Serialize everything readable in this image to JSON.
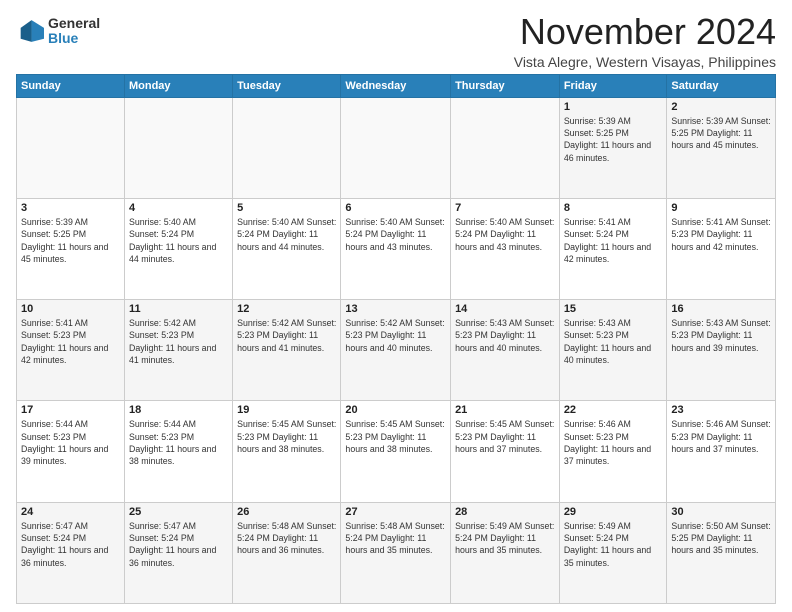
{
  "logo": {
    "general": "General",
    "blue": "Blue"
  },
  "header": {
    "month": "November 2024",
    "location": "Vista Alegre, Western Visayas, Philippines"
  },
  "weekdays": [
    "Sunday",
    "Monday",
    "Tuesday",
    "Wednesday",
    "Thursday",
    "Friday",
    "Saturday"
  ],
  "weeks": [
    [
      {
        "day": "",
        "info": ""
      },
      {
        "day": "",
        "info": ""
      },
      {
        "day": "",
        "info": ""
      },
      {
        "day": "",
        "info": ""
      },
      {
        "day": "",
        "info": ""
      },
      {
        "day": "1",
        "info": "Sunrise: 5:39 AM\nSunset: 5:25 PM\nDaylight: 11 hours\nand 46 minutes."
      },
      {
        "day": "2",
        "info": "Sunrise: 5:39 AM\nSunset: 5:25 PM\nDaylight: 11 hours\nand 45 minutes."
      }
    ],
    [
      {
        "day": "3",
        "info": "Sunrise: 5:39 AM\nSunset: 5:25 PM\nDaylight: 11 hours\nand 45 minutes."
      },
      {
        "day": "4",
        "info": "Sunrise: 5:40 AM\nSunset: 5:24 PM\nDaylight: 11 hours\nand 44 minutes."
      },
      {
        "day": "5",
        "info": "Sunrise: 5:40 AM\nSunset: 5:24 PM\nDaylight: 11 hours\nand 44 minutes."
      },
      {
        "day": "6",
        "info": "Sunrise: 5:40 AM\nSunset: 5:24 PM\nDaylight: 11 hours\nand 43 minutes."
      },
      {
        "day": "7",
        "info": "Sunrise: 5:40 AM\nSunset: 5:24 PM\nDaylight: 11 hours\nand 43 minutes."
      },
      {
        "day": "8",
        "info": "Sunrise: 5:41 AM\nSunset: 5:24 PM\nDaylight: 11 hours\nand 42 minutes."
      },
      {
        "day": "9",
        "info": "Sunrise: 5:41 AM\nSunset: 5:23 PM\nDaylight: 11 hours\nand 42 minutes."
      }
    ],
    [
      {
        "day": "10",
        "info": "Sunrise: 5:41 AM\nSunset: 5:23 PM\nDaylight: 11 hours\nand 42 minutes."
      },
      {
        "day": "11",
        "info": "Sunrise: 5:42 AM\nSunset: 5:23 PM\nDaylight: 11 hours\nand 41 minutes."
      },
      {
        "day": "12",
        "info": "Sunrise: 5:42 AM\nSunset: 5:23 PM\nDaylight: 11 hours\nand 41 minutes."
      },
      {
        "day": "13",
        "info": "Sunrise: 5:42 AM\nSunset: 5:23 PM\nDaylight: 11 hours\nand 40 minutes."
      },
      {
        "day": "14",
        "info": "Sunrise: 5:43 AM\nSunset: 5:23 PM\nDaylight: 11 hours\nand 40 minutes."
      },
      {
        "day": "15",
        "info": "Sunrise: 5:43 AM\nSunset: 5:23 PM\nDaylight: 11 hours\nand 40 minutes."
      },
      {
        "day": "16",
        "info": "Sunrise: 5:43 AM\nSunset: 5:23 PM\nDaylight: 11 hours\nand 39 minutes."
      }
    ],
    [
      {
        "day": "17",
        "info": "Sunrise: 5:44 AM\nSunset: 5:23 PM\nDaylight: 11 hours\nand 39 minutes."
      },
      {
        "day": "18",
        "info": "Sunrise: 5:44 AM\nSunset: 5:23 PM\nDaylight: 11 hours\nand 38 minutes."
      },
      {
        "day": "19",
        "info": "Sunrise: 5:45 AM\nSunset: 5:23 PM\nDaylight: 11 hours\nand 38 minutes."
      },
      {
        "day": "20",
        "info": "Sunrise: 5:45 AM\nSunset: 5:23 PM\nDaylight: 11 hours\nand 38 minutes."
      },
      {
        "day": "21",
        "info": "Sunrise: 5:45 AM\nSunset: 5:23 PM\nDaylight: 11 hours\nand 37 minutes."
      },
      {
        "day": "22",
        "info": "Sunrise: 5:46 AM\nSunset: 5:23 PM\nDaylight: 11 hours\nand 37 minutes."
      },
      {
        "day": "23",
        "info": "Sunrise: 5:46 AM\nSunset: 5:23 PM\nDaylight: 11 hours\nand 37 minutes."
      }
    ],
    [
      {
        "day": "24",
        "info": "Sunrise: 5:47 AM\nSunset: 5:24 PM\nDaylight: 11 hours\nand 36 minutes."
      },
      {
        "day": "25",
        "info": "Sunrise: 5:47 AM\nSunset: 5:24 PM\nDaylight: 11 hours\nand 36 minutes."
      },
      {
        "day": "26",
        "info": "Sunrise: 5:48 AM\nSunset: 5:24 PM\nDaylight: 11 hours\nand 36 minutes."
      },
      {
        "day": "27",
        "info": "Sunrise: 5:48 AM\nSunset: 5:24 PM\nDaylight: 11 hours\nand 35 minutes."
      },
      {
        "day": "28",
        "info": "Sunrise: 5:49 AM\nSunset: 5:24 PM\nDaylight: 11 hours\nand 35 minutes."
      },
      {
        "day": "29",
        "info": "Sunrise: 5:49 AM\nSunset: 5:24 PM\nDaylight: 11 hours\nand 35 minutes."
      },
      {
        "day": "30",
        "info": "Sunrise: 5:50 AM\nSunset: 5:25 PM\nDaylight: 11 hours\nand 35 minutes."
      }
    ]
  ]
}
